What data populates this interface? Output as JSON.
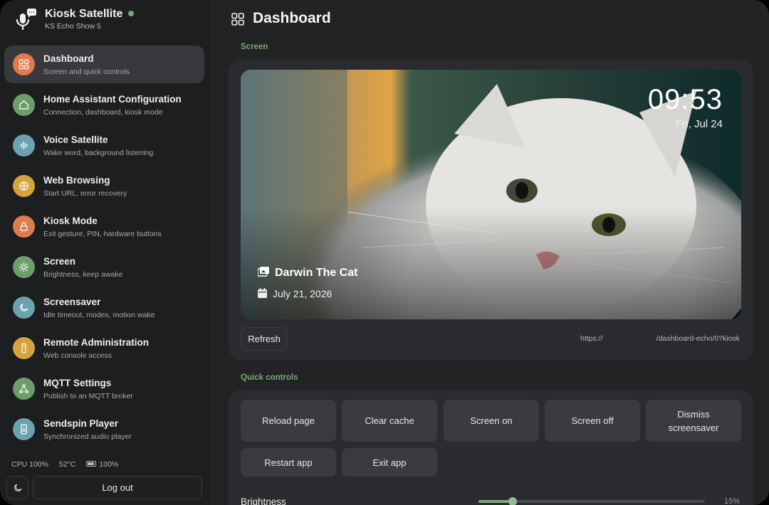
{
  "app": {
    "title": "Kiosk Satellite",
    "device": "KS Echo Show 5",
    "status_color": "#6fae6c"
  },
  "sidebar": {
    "items": [
      {
        "title": "Dashboard",
        "subtitle": "Screen and quick controls",
        "icon": "grid-icon",
        "color": "#e07a4f",
        "active": true
      },
      {
        "title": "Home Assistant Configuration",
        "subtitle": "Connection, dashboard, kiosk mode",
        "icon": "home-icon",
        "color": "#6c9e6a"
      },
      {
        "title": "Voice Satellite",
        "subtitle": "Wake word, background listening",
        "icon": "waveform-icon",
        "color": "#6aa2b0"
      },
      {
        "title": "Web Browsing",
        "subtitle": "Start URL, error recovery",
        "icon": "globe-icon",
        "color": "#d6a33c"
      },
      {
        "title": "Kiosk Mode",
        "subtitle": "Exit gesture, PIN, hardware buttons",
        "icon": "lock-icon",
        "color": "#e07a4f"
      },
      {
        "title": "Screen",
        "subtitle": "Brightness, keep awake",
        "icon": "sun-icon",
        "color": "#6c9e6a"
      },
      {
        "title": "Screensaver",
        "subtitle": "Idle timeout, modes, motion wake",
        "icon": "moon-icon",
        "color": "#6aa2b0"
      },
      {
        "title": "Remote Administration",
        "subtitle": "Web console access",
        "icon": "remote-icon",
        "color": "#d6a33c"
      },
      {
        "title": "MQTT Settings",
        "subtitle": "Publish to an MQTT broker",
        "icon": "network-icon",
        "color": "#6c9e6a"
      },
      {
        "title": "Sendspin Player",
        "subtitle": "Synchronized audio player",
        "icon": "speaker-icon",
        "color": "#6aa2b0"
      }
    ],
    "stats": {
      "cpu": "CPU 100%",
      "temp": "52°C",
      "battery": "100%"
    },
    "logout_label": "Log out"
  },
  "main": {
    "title": "Dashboard",
    "screen_label": "Screen",
    "preview": {
      "time": "09:53",
      "date": "Fri, Jul 24",
      "photo_title": "Darwin The Cat",
      "photo_date": "July 21, 2026"
    },
    "refresh_label": "Refresh",
    "url_prefix": "https://",
    "url_suffix": "/dashboard-echo/0?kiosk",
    "quick_controls_label": "Quick controls",
    "quick_controls": [
      "Reload page",
      "Clear cache",
      "Screen on",
      "Screen off",
      "Dismiss screensaver",
      "Restart app",
      "Exit app"
    ],
    "brightness_label": "Brightness",
    "brightness_value": "15%",
    "brightness_fraction": 0.15,
    "accent": "#79a877"
  }
}
